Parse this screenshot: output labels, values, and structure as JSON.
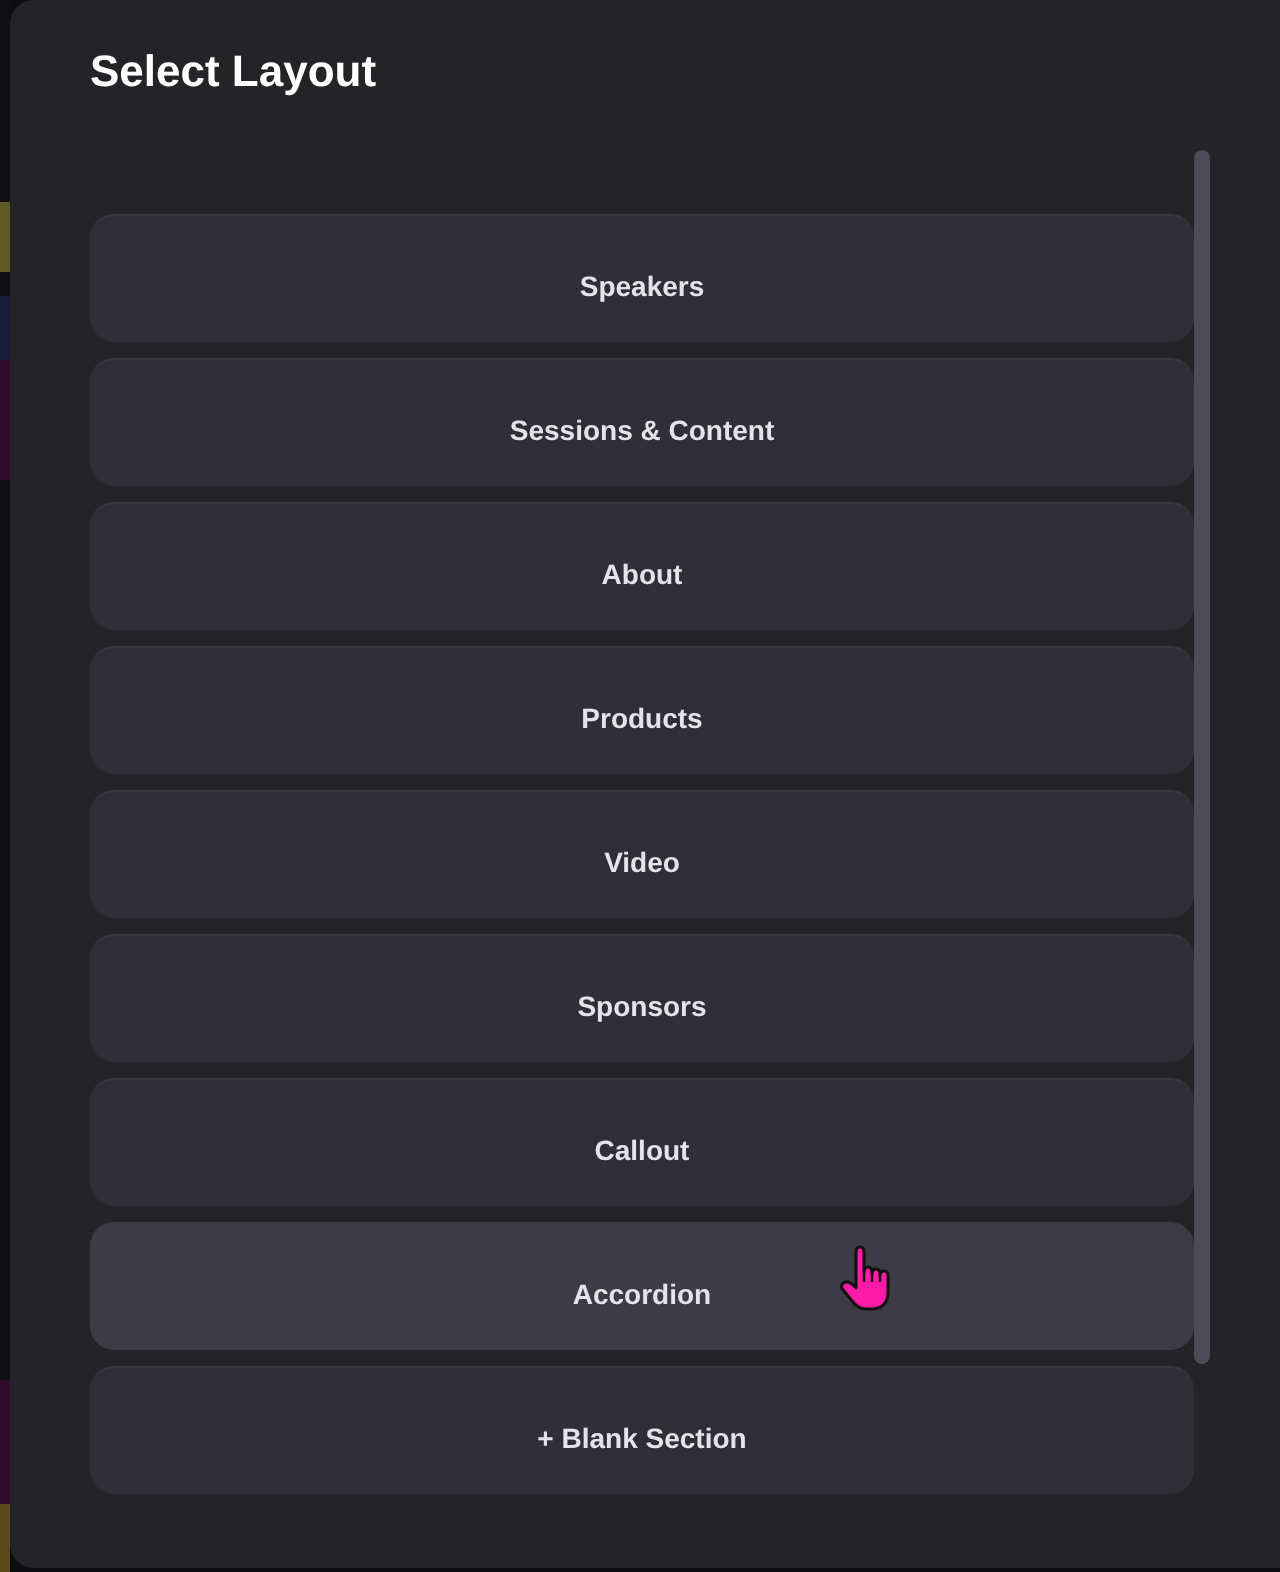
{
  "modal": {
    "title": "Select Layout",
    "layouts": [
      {
        "label": "Speakers",
        "hovered": false
      },
      {
        "label": "Sessions & Content",
        "hovered": false
      },
      {
        "label": "About",
        "hovered": false
      },
      {
        "label": "Products",
        "hovered": false
      },
      {
        "label": "Video",
        "hovered": false
      },
      {
        "label": "Sponsors",
        "hovered": false
      },
      {
        "label": "Callout",
        "hovered": false
      },
      {
        "label": "Accordion",
        "hovered": true
      },
      {
        "label": "+ Blank Section",
        "hovered": false
      }
    ]
  }
}
